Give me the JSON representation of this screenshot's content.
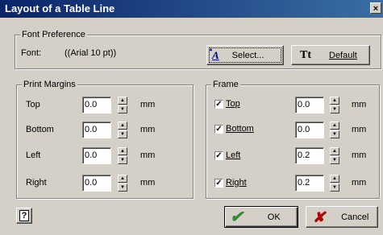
{
  "window": {
    "title": "Layout of a Table Line",
    "close_glyph": "×"
  },
  "font_preference": {
    "legend": "Font Preference",
    "font_label": "Font:",
    "font_value": "((Arial 10 pt))",
    "select_icon_text": "A",
    "select_label": "Select...",
    "default_icon_text": "Tt",
    "default_label": "Default"
  },
  "print_margins": {
    "legend": "Print Margins",
    "unit": "mm",
    "rows": [
      {
        "label": "Top",
        "value": "0.0"
      },
      {
        "label": "Bottom",
        "value": "0.0"
      },
      {
        "label": "Left",
        "value": "0.0"
      },
      {
        "label": "Right",
        "value": "0.0"
      }
    ]
  },
  "frame": {
    "legend": "Frame",
    "unit": "mm",
    "rows": [
      {
        "label": "Top",
        "checked": true,
        "value": "0.0"
      },
      {
        "label": "Bottom",
        "checked": true,
        "value": "0.0"
      },
      {
        "label": "Left",
        "checked": true,
        "value": "0.2"
      },
      {
        "label": "Right",
        "checked": true,
        "value": "0.2"
      }
    ]
  },
  "footer": {
    "help_glyph": "?",
    "ok_label": "OK",
    "cancel_label": "Cancel"
  },
  "colors": {
    "ok_check": "#2e8b2e",
    "cancel_x": "#b00000",
    "titlebar": "#0a246a"
  }
}
